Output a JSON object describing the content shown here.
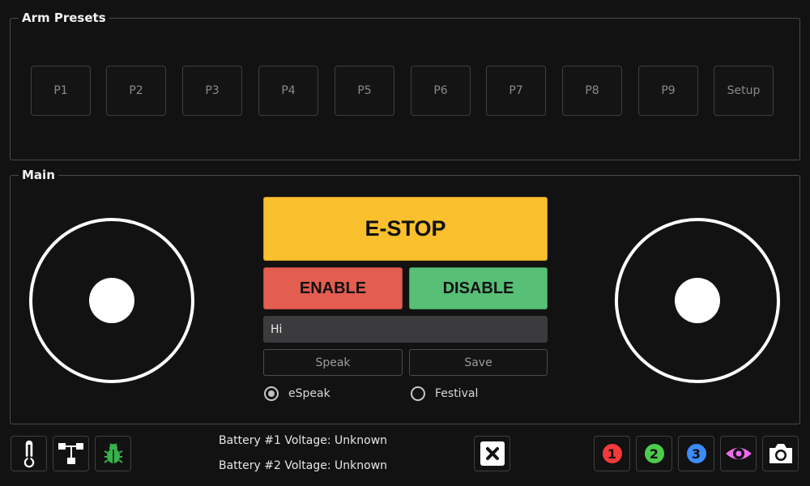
{
  "presets": {
    "title": "Arm Presets",
    "buttons": [
      "P1",
      "P2",
      "P3",
      "P4",
      "P5",
      "P6",
      "P7",
      "P8",
      "P9",
      "Setup"
    ]
  },
  "main": {
    "title": "Main",
    "estop_label": "E-STOP",
    "enable_label": "ENABLE",
    "disable_label": "DISABLE",
    "speech_text": "Hi",
    "speak_label": "Speak",
    "save_label": "Save",
    "tts_options": [
      {
        "label": "eSpeak",
        "selected": true
      },
      {
        "label": "Festival",
        "selected": false
      }
    ]
  },
  "status": {
    "battery1": "Battery #1 Voltage: Unknown",
    "battery2": "Battery #2 Voltage: Unknown"
  },
  "toolbar_left": [
    {
      "icon": "thermometer-icon"
    },
    {
      "icon": "network-tree-icon"
    },
    {
      "icon": "bug-icon",
      "color": "#36b34a"
    }
  ],
  "toolbar_right": [
    {
      "icon": "camera-1-icon",
      "text": "1",
      "color": "#f23a3a"
    },
    {
      "icon": "camera-2-icon",
      "text": "2",
      "color": "#4ccb4c"
    },
    {
      "icon": "camera-3-icon",
      "text": "3",
      "color": "#3b8cff"
    },
    {
      "icon": "eye-icon",
      "color": "#f06af0"
    },
    {
      "icon": "camera-icon"
    }
  ],
  "colors": {
    "estop": "#fbc02d",
    "enable": "#e35d50",
    "disable": "#57bf76"
  }
}
